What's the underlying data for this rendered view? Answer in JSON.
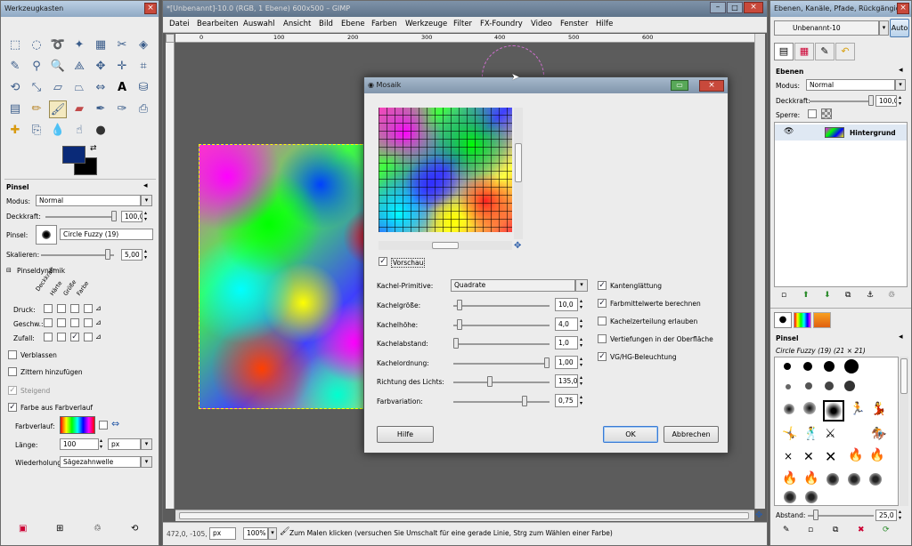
{
  "toolbox": {
    "title": "Werkzeugkasten",
    "pinsel_header": "Pinsel",
    "modus_label": "Modus:",
    "modus_value": "Normal",
    "deckkraft_label": "Deckkraft:",
    "deckkraft_value": "100,0",
    "pinsel_label": "Pinsel:",
    "pinsel_value": "Circle Fuzzy (19)",
    "skalieren_label": "Skalieren:",
    "skalieren_value": "5,00",
    "dynamik_label": "Pinseldynamik",
    "dynamik_cols": [
      "Deckkraft",
      "Härte",
      "Größe",
      "Farbe"
    ],
    "druck_label": "Druck:",
    "geschw_label": "Geschw.:",
    "zufall_label": "Zufall:",
    "verblassen_label": "Verblassen",
    "zittern_label": "Zittern hinzufügen",
    "steigend_label": "Steigend",
    "farbe_verlauf_label": "Farbe aus Farbverlauf",
    "farbverlauf_label": "Farbverlauf:",
    "laenge_label": "Länge:",
    "laenge_value": "100",
    "laenge_unit": "px",
    "wiederholung_label": "Wiederholung:",
    "wiederholung_value": "Sägezahnwelle"
  },
  "main": {
    "title": "*[Unbenannt]-10.0 (RGB, 1 Ebene) 600x500 – GIMP",
    "menu": [
      "Datei",
      "Bearbeiten",
      "Auswahl",
      "Ansicht",
      "Bild",
      "Ebene",
      "Farben",
      "Werkzeuge",
      "Filter",
      "FX-Foundry",
      "Video",
      "Fenster",
      "Hilfe"
    ],
    "ruler_ticks": [
      "0",
      "100",
      "200",
      "300",
      "400",
      "500",
      "600"
    ],
    "status_coords": "472,0, -105,",
    "status_unit": "px",
    "status_zoom": "100%",
    "status_text": "Zum Malen klicken (versuchen Sie Umschalt für eine gerade Linie, Strg zum Wählen einer Farbe)"
  },
  "dialog": {
    "title": "Mosaik",
    "preview_label": "Vorschau",
    "kachel_primitive_label": "Kachel-Primitive:",
    "kachel_primitive_value": "Quadrate",
    "params": [
      {
        "label": "Kachelgröße:",
        "value": "10,0",
        "level": 0.04
      },
      {
        "label": "Kachelhöhe:",
        "value": "4,0",
        "level": 0.04
      },
      {
        "label": "Kachelabstand:",
        "value": "1,0",
        "level": 0.0
      },
      {
        "label": "Kachelordnung:",
        "value": "1,00",
        "level": 1.0
      },
      {
        "label": "Richtung des Lichts:",
        "value": "135,0",
        "level": 0.375
      },
      {
        "label": "Farbvariation:",
        "value": "0,75",
        "level": 0.75
      }
    ],
    "options": [
      {
        "label": "Kantenglättung",
        "checked": true
      },
      {
        "label": "Farbmittelwerte berechnen",
        "checked": true
      },
      {
        "label": "Kachelzerteilung erlauben",
        "checked": false
      },
      {
        "label": "Vertiefungen in der Oberfläche",
        "checked": false
      },
      {
        "label": "VG/HG-Beleuchtung",
        "checked": true
      }
    ],
    "help_button": "Hilfe",
    "ok_button": "OK",
    "cancel_button": "Abbrechen"
  },
  "layers": {
    "title": "Ebenen, Kanäle, Pfade, Rückgängig...",
    "image_name": "Unbenannt-10",
    "auto_button": "Auto",
    "ebenen_header": "Ebenen",
    "modus_label": "Modus:",
    "modus_value": "Normal",
    "deckkraft_label": "Deckkraft:",
    "deckkraft_value": "100,0",
    "sperre_label": "Sperre:",
    "layer_name": "Hintergrund",
    "pinsel_header": "Pinsel",
    "brush_name": "Circle Fuzzy (19) (21 × 21)",
    "abstand_label": "Abstand:",
    "abstand_value": "25,0"
  }
}
